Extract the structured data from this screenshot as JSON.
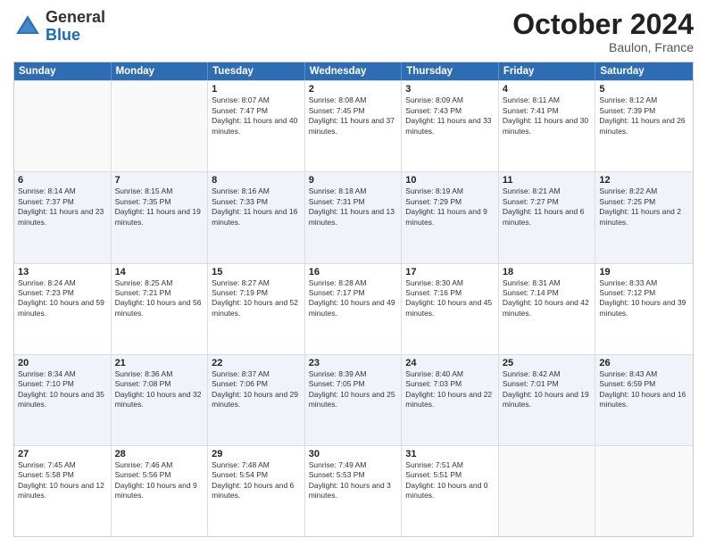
{
  "header": {
    "logo_general": "General",
    "logo_blue": "Blue",
    "month_title": "October 2024",
    "location": "Baulon, France"
  },
  "days_of_week": [
    "Sunday",
    "Monday",
    "Tuesday",
    "Wednesday",
    "Thursday",
    "Friday",
    "Saturday"
  ],
  "rows": [
    [
      {
        "day": "",
        "sunrise": "",
        "sunset": "",
        "daylight": "",
        "empty": true
      },
      {
        "day": "",
        "sunrise": "",
        "sunset": "",
        "daylight": "",
        "empty": true
      },
      {
        "day": "1",
        "sunrise": "Sunrise: 8:07 AM",
        "sunset": "Sunset: 7:47 PM",
        "daylight": "Daylight: 11 hours and 40 minutes."
      },
      {
        "day": "2",
        "sunrise": "Sunrise: 8:08 AM",
        "sunset": "Sunset: 7:45 PM",
        "daylight": "Daylight: 11 hours and 37 minutes."
      },
      {
        "day": "3",
        "sunrise": "Sunrise: 8:09 AM",
        "sunset": "Sunset: 7:43 PM",
        "daylight": "Daylight: 11 hours and 33 minutes."
      },
      {
        "day": "4",
        "sunrise": "Sunrise: 8:11 AM",
        "sunset": "Sunset: 7:41 PM",
        "daylight": "Daylight: 11 hours and 30 minutes."
      },
      {
        "day": "5",
        "sunrise": "Sunrise: 8:12 AM",
        "sunset": "Sunset: 7:39 PM",
        "daylight": "Daylight: 11 hours and 26 minutes."
      }
    ],
    [
      {
        "day": "6",
        "sunrise": "Sunrise: 8:14 AM",
        "sunset": "Sunset: 7:37 PM",
        "daylight": "Daylight: 11 hours and 23 minutes."
      },
      {
        "day": "7",
        "sunrise": "Sunrise: 8:15 AM",
        "sunset": "Sunset: 7:35 PM",
        "daylight": "Daylight: 11 hours and 19 minutes."
      },
      {
        "day": "8",
        "sunrise": "Sunrise: 8:16 AM",
        "sunset": "Sunset: 7:33 PM",
        "daylight": "Daylight: 11 hours and 16 minutes."
      },
      {
        "day": "9",
        "sunrise": "Sunrise: 8:18 AM",
        "sunset": "Sunset: 7:31 PM",
        "daylight": "Daylight: 11 hours and 13 minutes."
      },
      {
        "day": "10",
        "sunrise": "Sunrise: 8:19 AM",
        "sunset": "Sunset: 7:29 PM",
        "daylight": "Daylight: 11 hours and 9 minutes."
      },
      {
        "day": "11",
        "sunrise": "Sunrise: 8:21 AM",
        "sunset": "Sunset: 7:27 PM",
        "daylight": "Daylight: 11 hours and 6 minutes."
      },
      {
        "day": "12",
        "sunrise": "Sunrise: 8:22 AM",
        "sunset": "Sunset: 7:25 PM",
        "daylight": "Daylight: 11 hours and 2 minutes."
      }
    ],
    [
      {
        "day": "13",
        "sunrise": "Sunrise: 8:24 AM",
        "sunset": "Sunset: 7:23 PM",
        "daylight": "Daylight: 10 hours and 59 minutes."
      },
      {
        "day": "14",
        "sunrise": "Sunrise: 8:25 AM",
        "sunset": "Sunset: 7:21 PM",
        "daylight": "Daylight: 10 hours and 56 minutes."
      },
      {
        "day": "15",
        "sunrise": "Sunrise: 8:27 AM",
        "sunset": "Sunset: 7:19 PM",
        "daylight": "Daylight: 10 hours and 52 minutes."
      },
      {
        "day": "16",
        "sunrise": "Sunrise: 8:28 AM",
        "sunset": "Sunset: 7:17 PM",
        "daylight": "Daylight: 10 hours and 49 minutes."
      },
      {
        "day": "17",
        "sunrise": "Sunrise: 8:30 AM",
        "sunset": "Sunset: 7:16 PM",
        "daylight": "Daylight: 10 hours and 45 minutes."
      },
      {
        "day": "18",
        "sunrise": "Sunrise: 8:31 AM",
        "sunset": "Sunset: 7:14 PM",
        "daylight": "Daylight: 10 hours and 42 minutes."
      },
      {
        "day": "19",
        "sunrise": "Sunrise: 8:33 AM",
        "sunset": "Sunset: 7:12 PM",
        "daylight": "Daylight: 10 hours and 39 minutes."
      }
    ],
    [
      {
        "day": "20",
        "sunrise": "Sunrise: 8:34 AM",
        "sunset": "Sunset: 7:10 PM",
        "daylight": "Daylight: 10 hours and 35 minutes."
      },
      {
        "day": "21",
        "sunrise": "Sunrise: 8:36 AM",
        "sunset": "Sunset: 7:08 PM",
        "daylight": "Daylight: 10 hours and 32 minutes."
      },
      {
        "day": "22",
        "sunrise": "Sunrise: 8:37 AM",
        "sunset": "Sunset: 7:06 PM",
        "daylight": "Daylight: 10 hours and 29 minutes."
      },
      {
        "day": "23",
        "sunrise": "Sunrise: 8:39 AM",
        "sunset": "Sunset: 7:05 PM",
        "daylight": "Daylight: 10 hours and 25 minutes."
      },
      {
        "day": "24",
        "sunrise": "Sunrise: 8:40 AM",
        "sunset": "Sunset: 7:03 PM",
        "daylight": "Daylight: 10 hours and 22 minutes."
      },
      {
        "day": "25",
        "sunrise": "Sunrise: 8:42 AM",
        "sunset": "Sunset: 7:01 PM",
        "daylight": "Daylight: 10 hours and 19 minutes."
      },
      {
        "day": "26",
        "sunrise": "Sunrise: 8:43 AM",
        "sunset": "Sunset: 6:59 PM",
        "daylight": "Daylight: 10 hours and 16 minutes."
      }
    ],
    [
      {
        "day": "27",
        "sunrise": "Sunrise: 7:45 AM",
        "sunset": "Sunset: 5:58 PM",
        "daylight": "Daylight: 10 hours and 12 minutes."
      },
      {
        "day": "28",
        "sunrise": "Sunrise: 7:46 AM",
        "sunset": "Sunset: 5:56 PM",
        "daylight": "Daylight: 10 hours and 9 minutes."
      },
      {
        "day": "29",
        "sunrise": "Sunrise: 7:48 AM",
        "sunset": "Sunset: 5:54 PM",
        "daylight": "Daylight: 10 hours and 6 minutes."
      },
      {
        "day": "30",
        "sunrise": "Sunrise: 7:49 AM",
        "sunset": "Sunset: 5:53 PM",
        "daylight": "Daylight: 10 hours and 3 minutes."
      },
      {
        "day": "31",
        "sunrise": "Sunrise: 7:51 AM",
        "sunset": "Sunset: 5:51 PM",
        "daylight": "Daylight: 10 hours and 0 minutes."
      },
      {
        "day": "",
        "sunrise": "",
        "sunset": "",
        "daylight": "",
        "empty": true
      },
      {
        "day": "",
        "sunrise": "",
        "sunset": "",
        "daylight": "",
        "empty": true
      }
    ]
  ],
  "alt_rows": [
    1,
    3
  ]
}
